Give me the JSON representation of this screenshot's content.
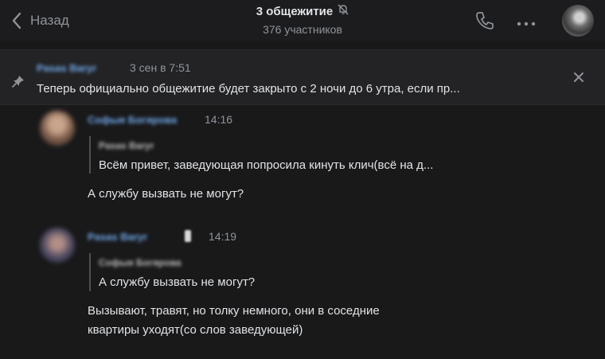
{
  "header": {
    "back_label": "Назад",
    "title": "3 общежитие",
    "subtitle": "376 участников",
    "icons": [
      "chevron-left-icon",
      "muted-bell-icon",
      "phone-icon",
      "more-icon"
    ]
  },
  "pinned": {
    "author": "Pasas Baryr",
    "date": "3 сен в 7:51",
    "text": "Теперь официально общежитие будет закрыто с 2 ночи до 6 утра, если пр..."
  },
  "messages": [
    {
      "author": "Софыя Богярова",
      "time": "14:16",
      "reply_author": "Pasas Baryr",
      "reply_text": "Всём привет, заведующая попросила кинуть клич(всё на д...",
      "lines": [
        "А службу вызвать не могут?"
      ]
    },
    {
      "author": "Pasas Baryr",
      "time": "14:19",
      "reply_author": "Софыя Богярова",
      "reply_text": "А службу вызвать не могут?",
      "lines": [
        "Вызывают, травят, но толку немного, они в соседние",
        "квартиры уходят(со слов заведующей)"
      ]
    }
  ],
  "colors": {
    "background": "#19191a",
    "link": "#71aaeb",
    "muted": "#8f9399"
  }
}
